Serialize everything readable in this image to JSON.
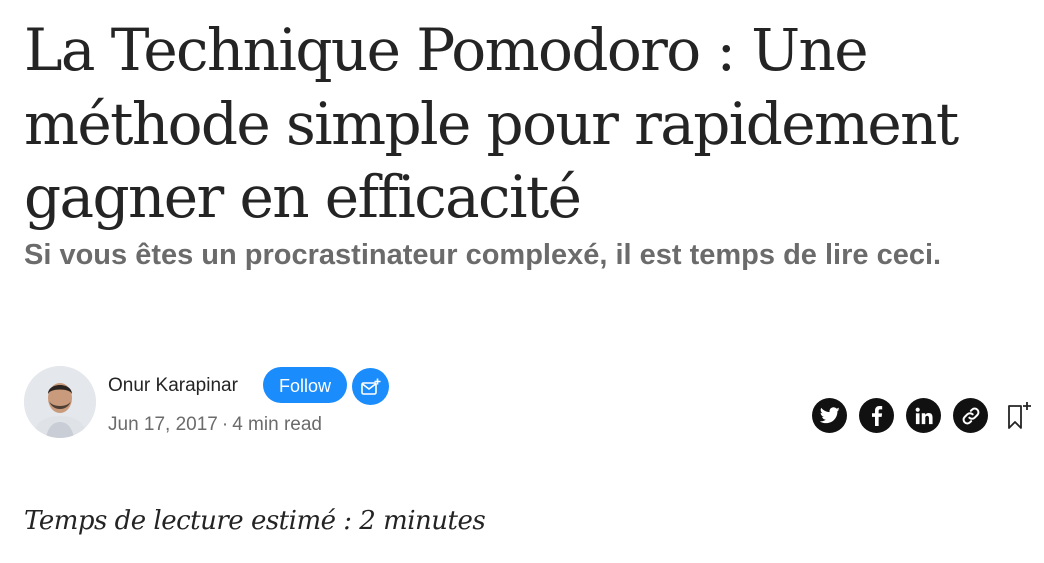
{
  "article": {
    "title": "La Technique Pomodoro : Une méthode simple pour rapidement gagner en efficacité",
    "subtitle": "Si vous êtes un procrastinateur complexé, il est temps de lire ceci.",
    "intro": "Temps de lecture estimé : 2 minutes"
  },
  "author": {
    "name": "Onur Karapinar",
    "follow_label": "Follow",
    "subscribe_icon": "mail-plus-icon",
    "avatar_icon": "avatar"
  },
  "meta": {
    "date": "Jun 17, 2017",
    "separator": "·",
    "read_time": "4 min read"
  },
  "share": {
    "icons": [
      "twitter-icon",
      "facebook-icon",
      "linkedin-icon",
      "link-icon",
      "bookmark-icon"
    ]
  },
  "colors": {
    "text": "#242424",
    "muted": "#6b6b6b",
    "accent": "#1a8cfb",
    "share_bg": "#111111"
  }
}
